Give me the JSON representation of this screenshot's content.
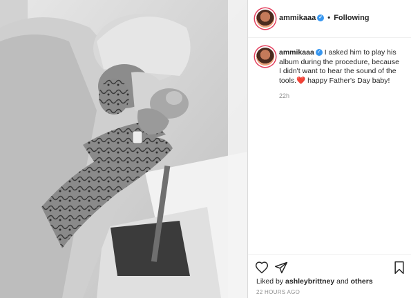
{
  "post": {
    "username": "ammikaaa",
    "verified_icon": "verified-badge-icon",
    "separator": "•",
    "follow_status": "Following",
    "caption": {
      "username": "ammikaaa",
      "text": "I asked him to play his album during the procedure, because I didn't want to hear the sound of the tools.",
      "emoji": "❤️",
      "text_after": " happy Father's Day baby!"
    },
    "caption_time": "22h",
    "likes": {
      "prefix": "Liked by",
      "user": "ashleybrittney",
      "conjunction": "and",
      "others": "others"
    },
    "posted_ago": "22 HOURS AGO"
  },
  "icons": {
    "like": "heart-icon",
    "share": "paper-plane-icon",
    "save": "bookmark-icon"
  },
  "colors": {
    "verified": "#3897f0",
    "heart": "#e0245e",
    "muted": "#8e8e8e"
  }
}
